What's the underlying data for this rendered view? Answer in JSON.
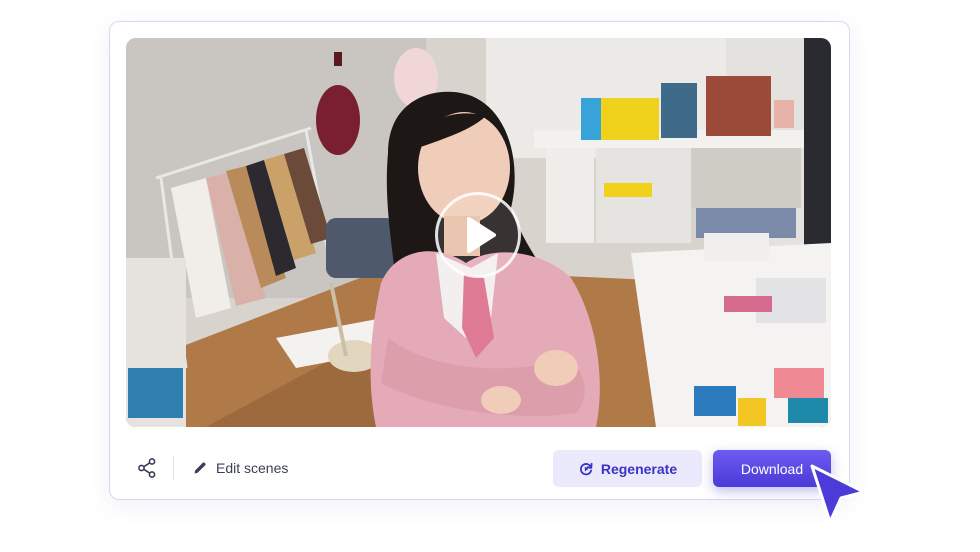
{
  "video": {
    "alt": "Woman in a pink blazer in a fashion studio",
    "play_icon": "play-icon"
  },
  "toolbar": {
    "share_icon": "share-icon",
    "edit_icon": "pencil-icon",
    "edit_label": "Edit scenes",
    "regenerate_icon": "refresh-icon",
    "regenerate_label": "Regenerate",
    "download_label": "Download"
  },
  "colors": {
    "accent": "#4b3bd8",
    "accent_light": "#ebe9fc",
    "accent_text": "#3b33c4",
    "text": "#3a3f55"
  }
}
